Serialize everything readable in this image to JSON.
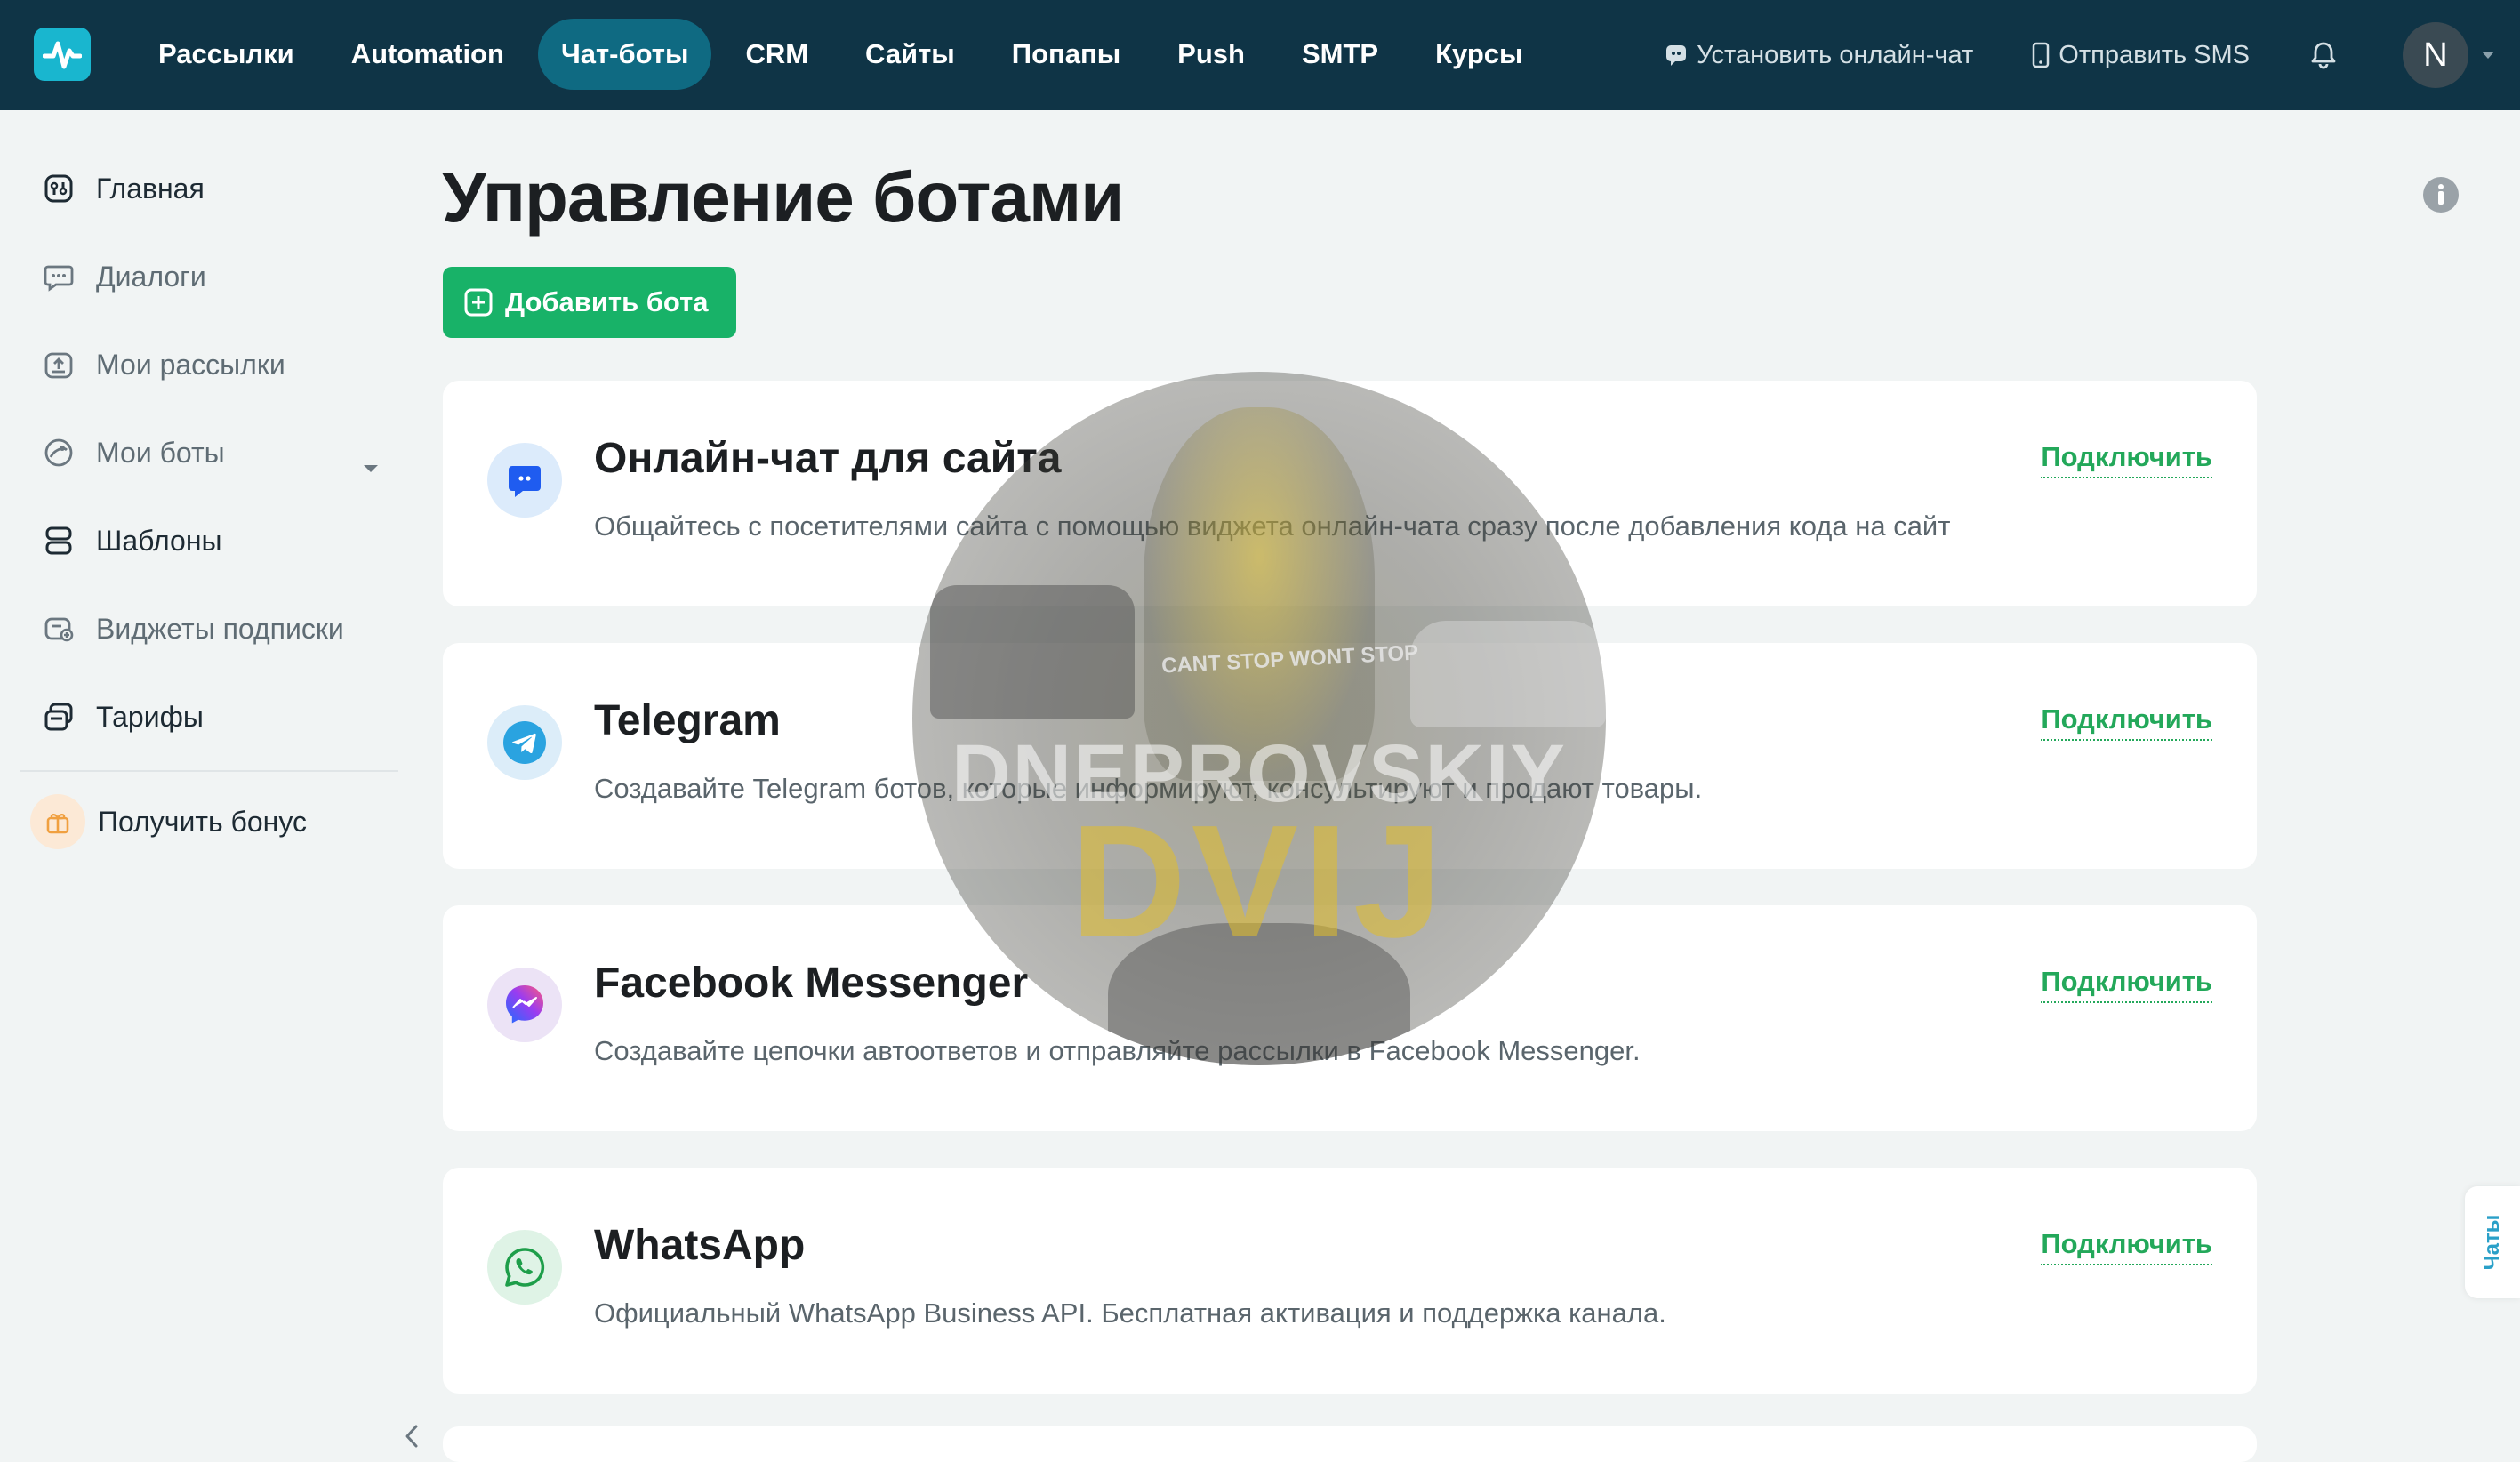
{
  "topbar": {
    "nav": [
      {
        "label": "Рассылки",
        "active": false
      },
      {
        "label": "Automation",
        "active": false
      },
      {
        "label": "Чат-боты",
        "active": true
      },
      {
        "label": "CRM",
        "active": false
      },
      {
        "label": "Сайты",
        "active": false
      },
      {
        "label": "Попапы",
        "active": false
      },
      {
        "label": "Push",
        "active": false
      },
      {
        "label": "SMTP",
        "active": false
      },
      {
        "label": "Курсы",
        "active": false
      }
    ],
    "install_chat_label": "Установить онлайн-чат",
    "send_sms_label": "Отправить SMS",
    "avatar_letter": "N",
    "icons": {
      "logo": "pulse-logo-icon",
      "chat": "chat-bubble-icon",
      "phone": "phone-icon",
      "bell": "bell-icon",
      "caret": "chevron-down-icon"
    }
  },
  "sidebar": {
    "items": [
      {
        "label": "Главная",
        "icon": "dashboard-icon"
      },
      {
        "label": "Диалоги",
        "icon": "dialogs-icon"
      },
      {
        "label": "Мои рассылки",
        "icon": "mailings-icon"
      },
      {
        "label": "Мои боты",
        "icon": "bots-icon"
      },
      {
        "label": "Шаблоны",
        "icon": "templates-icon"
      },
      {
        "label": "Виджеты подписки",
        "icon": "widgets-icon"
      },
      {
        "label": "Тарифы",
        "icon": "tariffs-icon"
      }
    ],
    "bonus_label": "Получить бонус"
  },
  "main": {
    "title": "Управление ботами",
    "add_button_label": "Добавить бота",
    "cards": [
      {
        "title": "Онлайн-чат для сайта",
        "description": "Общайтесь с посетителями сайта с помощью виджета онлайн-чата сразу после добавления кода на сайт",
        "action": "Подключить",
        "icon": "online-chat-icon"
      },
      {
        "title": "Telegram",
        "description": "Создавайте Telegram ботов, которые информируют, консультируют и продают товары.",
        "action": "Подключить",
        "icon": "telegram-icon"
      },
      {
        "title": "Facebook Messenger",
        "description": "Создавайте цепочки автоответов и отправляйте рассылки в Facebook Messenger.",
        "action": "Подключить",
        "icon": "messenger-icon"
      },
      {
        "title": "WhatsApp",
        "description": "Официальный WhatsApp Business API. Бесплатная активация и поддержка канала.",
        "action": "Подключить",
        "icon": "whatsapp-icon"
      }
    ]
  },
  "watermark": {
    "tag": "CANT STOP WONT STOP",
    "line1": "DNEPROVSKIY",
    "line2": "DVIJ"
  },
  "chats_tab_label": "Чаты",
  "colors": {
    "topbar": "#0f3446",
    "nav_active": "#0f6a82",
    "accent_green": "#18b268",
    "link_green": "#23a85a",
    "background": "#f1f4f4"
  }
}
